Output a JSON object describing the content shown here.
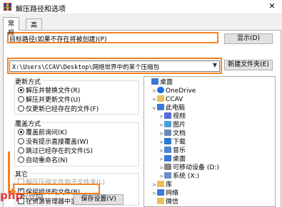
{
  "window": {
    "title": "解压路径和选项",
    "close_glyph": "✕"
  },
  "tabs": [
    {
      "label": "常规",
      "active": true
    },
    {
      "label": "高级",
      "active": false
    }
  ],
  "destination": {
    "label": "目标路径(如果不存在将被创建)(P)",
    "path": "X:\\Users\\CCAV\\Desktop\\网络世界中的某个压缩包",
    "show_button": "显示(D)",
    "new_folder_button": "新建文件夹(E)"
  },
  "update_mode": {
    "title": "更新方式",
    "options": [
      {
        "label": "解压并替换文件(R)",
        "checked": true
      },
      {
        "label": "解压并更新文件(U)",
        "checked": false
      },
      {
        "label": "仅更新已经存在的文件(F)",
        "checked": false
      }
    ]
  },
  "overwrite_mode": {
    "title": "覆盖方式",
    "options": [
      {
        "label": "覆盖前询问(K)",
        "checked": true
      },
      {
        "label": "没有提示直接覆盖(W)",
        "checked": false
      },
      {
        "label": "跳过已经存在的文件(S)",
        "checked": false
      },
      {
        "label": "自动重命名(N)",
        "checked": false
      }
    ]
  },
  "misc": {
    "title": "其它",
    "options": [
      {
        "label": "解压压缩文件到子文件夹(L)",
        "checked": false,
        "disabled": true
      },
      {
        "label": "保留损坏的文件(B)",
        "checked": true,
        "disabled": false
      },
      {
        "label": "在资源管理器中显示文件(X)",
        "checked": false,
        "disabled": false
      }
    ]
  },
  "tree": {
    "items": [
      {
        "label": "桌面",
        "icon": "desktop-icon",
        "color": "#3a7bd5"
      },
      {
        "label": "OneDrive",
        "icon": "cloud-icon",
        "color": "#1e6fd9",
        "toggle": ">"
      },
      {
        "label": "CCAV",
        "icon": "user-folder-icon",
        "color": "#e8c15a",
        "toggle": ">"
      },
      {
        "label": "此电脑",
        "icon": "computer-icon",
        "color": "#3a7bd5",
        "toggle": "v"
      },
      {
        "label": "视频",
        "icon": "video-icon",
        "color": "#5b6bd8",
        "toggle": ">"
      },
      {
        "label": "图片",
        "icon": "picture-icon",
        "color": "#4a9fd8",
        "toggle": ">"
      },
      {
        "label": "文档",
        "icon": "document-icon",
        "color": "#6f8bb5",
        "toggle": ">"
      },
      {
        "label": "下载",
        "icon": "download-icon",
        "color": "#2b78d3",
        "toggle": ">"
      },
      {
        "label": "音乐",
        "icon": "music-icon",
        "color": "#4a86d1",
        "toggle": ">"
      },
      {
        "label": "桌面",
        "icon": "desktop-icon",
        "color": "#3a7bd5",
        "toggle": ">"
      },
      {
        "label": "可移动设备 (D:)",
        "icon": "drive-icon",
        "color": "#888888",
        "toggle": ">"
      },
      {
        "label": "系统 (X:)",
        "icon": "system-drive-icon",
        "color": "#6a8fc8",
        "toggle": ">"
      },
      {
        "label": "库",
        "icon": "library-icon",
        "color": "#e8c15a",
        "toggle": ">"
      },
      {
        "label": "网络",
        "icon": "network-icon",
        "color": "#3a7bd5",
        "toggle": ">"
      },
      {
        "label": "微信",
        "icon": "folder-icon",
        "color": "#e8c15a"
      }
    ]
  },
  "save_button": "保存设置(V)",
  "watermark": {
    "logo": "php",
    "text": "中文网"
  },
  "accent_color": "#f5821f"
}
